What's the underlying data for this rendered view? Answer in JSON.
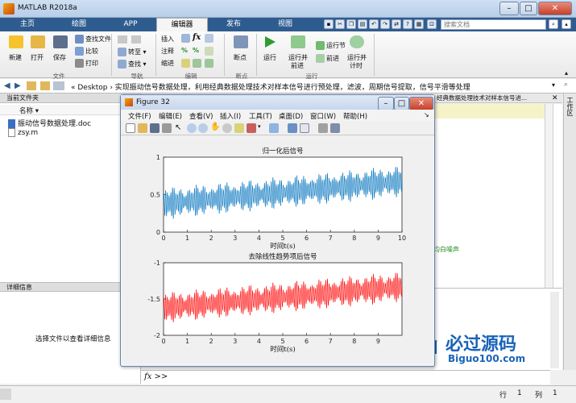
{
  "window": {
    "title": "MATLAB R2018a",
    "min": "–",
    "max": "□",
    "close": "✕"
  },
  "tabs": [
    "主页",
    "绘图",
    "APP",
    "编辑器",
    "发布",
    "视图"
  ],
  "search": {
    "placeholder": "搜索文档"
  },
  "ribbon": {
    "new": "新建",
    "open": "打开",
    "save": "保存",
    "findfiles": "查找文件",
    "compare": "比较",
    "print": "打印",
    "goto": "转至",
    "find": "查找",
    "insert": "插入",
    "comment": "注释",
    "indent": "缩进",
    "fx": "fx",
    "breakpoints": "断点",
    "run": "运行",
    "runadvance": [
      "运行并",
      "前进"
    ],
    "runsection": "运行节",
    "advance": "前进",
    "runtime": [
      "运行并",
      "计时"
    ],
    "groups": {
      "file": "文件",
      "nav": "导航",
      "edit": "编辑",
      "bp": "断点",
      "run": "运行"
    }
  },
  "address": {
    "path": "« Desktop › 实现振动信号数据处理，利用经典数据处理技术对样本信号进行预处理，滤波，周期信号提取，信号平滑等处理"
  },
  "left": {
    "header": "当前文件夹",
    "col": "名称 ▾",
    "files": [
      "振动信号数据处理.doc",
      "zsy.m"
    ],
    "detail_header": "详细信息",
    "detail_text": "选择文件以查看详细信息"
  },
  "right": {
    "tabtext": "经典数据处理技术对样本信号进...",
    "workspace_tab": "工作区",
    "green_text": "均白噪声"
  },
  "figure": {
    "title": "Figure 32",
    "menu": [
      "文件(F)",
      "编辑(E)",
      "查看(V)",
      "插入(I)",
      "工具(T)",
      "桌面(D)",
      "窗口(W)",
      "帮助(H)"
    ]
  },
  "command": {
    "prompt": "fx >>"
  },
  "status": {
    "row_label": "行",
    "row": "1",
    "col_label": "列",
    "col": "1"
  },
  "watermark": {
    "main": "必过源码",
    "sub": "Biguo100.com"
  },
  "chart_data": [
    {
      "type": "line",
      "title": "归一化后信号",
      "xlabel": "时间t(s)",
      "ylabel": "",
      "xlim": [
        0,
        10
      ],
      "ylim": [
        0,
        1
      ],
      "xticks": [
        0,
        1,
        2,
        3,
        4,
        5,
        6,
        7,
        8,
        9,
        10
      ],
      "yticks": [
        0,
        0.5,
        1
      ],
      "color": "#0072bd",
      "trend": {
        "x": [
          0,
          10
        ],
        "center": [
          0.38,
          0.68
        ]
      },
      "amplitude": 0.22
    },
    {
      "type": "line",
      "title": "去除线性趋势项后信号",
      "xlabel": "时间t(s)",
      "ylabel": "",
      "xlim": [
        0,
        10
      ],
      "ylim": [
        -2,
        -1
      ],
      "xticks": [
        0,
        1,
        2,
        3,
        4,
        5,
        6,
        7,
        8,
        9
      ],
      "yticks": [
        -2,
        -1.5,
        -1
      ],
      "color": "#ff0000",
      "trend": {
        "x": [
          0,
          10
        ],
        "center": [
          -1.62,
          -1.33
        ]
      },
      "amplitude": 0.22
    }
  ]
}
